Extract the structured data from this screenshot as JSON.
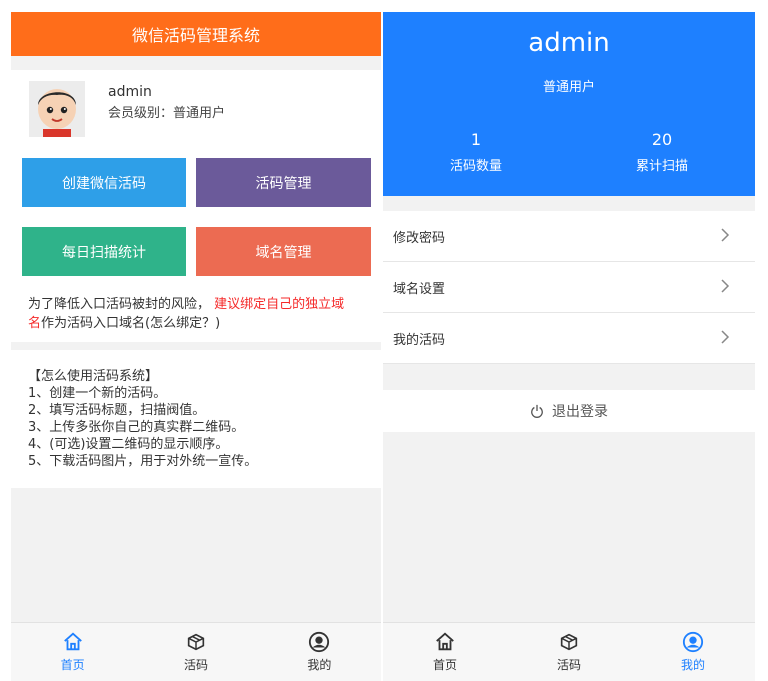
{
  "left": {
    "header_title": "微信活码管理系统",
    "profile": {
      "name": "admin",
      "level_label": "会员级别：",
      "level_value": "普通用户"
    },
    "actions": {
      "create": "创建微信活码",
      "manage": "活码管理",
      "stats": "每日扫描统计",
      "domain": "域名管理"
    },
    "notice": {
      "text1": "为了降低入口活码被封的风险，",
      "warn_a": "建议绑定自己的独立域",
      "warn_b": "名",
      "text2": "作为活码入口域名(怎么绑定？)"
    },
    "howto": {
      "title": "【怎么使用活码系统】",
      "steps": [
        "1、创建一个新的活码。",
        "2、填写活码标题，扫描阀值。",
        "3、上传多张你自己的真实群二维码。",
        "4、(可选)设置二维码的显示顺序。",
        "5、下载活码图片，用于对外统一宣传。"
      ]
    },
    "tabs": [
      "首页",
      "活码",
      "我的"
    ]
  },
  "right": {
    "name": "admin",
    "level": "普通用户",
    "stats": {
      "count_value": "1",
      "count_label": "活码数量",
      "scan_value": "20",
      "scan_label": "累计扫描"
    },
    "menu": [
      "修改密码",
      "域名设置",
      "我的活码"
    ],
    "logout": "退出登录",
    "tabs": [
      "首页",
      "活码",
      "我的"
    ]
  },
  "colors": {
    "orange": "#ff6d1a",
    "blue": "#1e80ff",
    "create_btn": "#2e9fe8",
    "manage_btn": "#6b5a9a",
    "stats_btn": "#2fb38a",
    "domain_btn": "#ec6b52",
    "warn_text": "#f52a2a"
  },
  "icons": {
    "home": "home-icon",
    "code": "box-icon",
    "mine": "user-circle-icon",
    "chevron": "chevron-right-icon",
    "power": "power-icon"
  }
}
